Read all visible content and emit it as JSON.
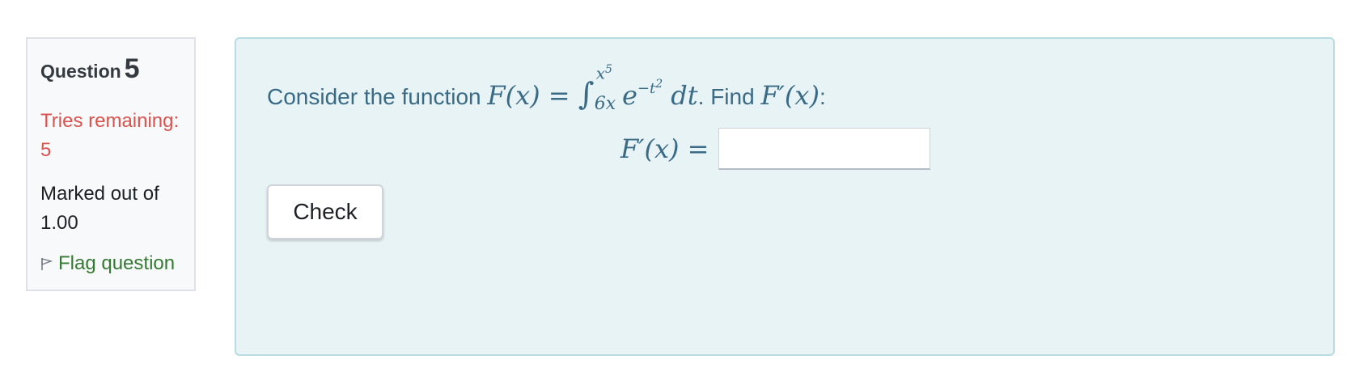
{
  "info": {
    "question_label": "Question",
    "question_number": "5",
    "tries_remaining": "Tries remaining: 5",
    "marked_out_of": "Marked out of 1.00",
    "flag_label": "Flag question"
  },
  "question": {
    "intro_text": "Consider the function",
    "function_lhs": "F(x) =",
    "integral_upper": "x",
    "integral_upper_exp": "5",
    "integral_lower": "6x",
    "integrand_base": "e",
    "integrand_exp": "−t",
    "integrand_exp_sq": "2",
    "differential": "dt",
    "find_text": ". Find",
    "find_target": "F′(x)",
    "find_colon": ":"
  },
  "answer": {
    "lhs": "F′(x) =",
    "value": "",
    "placeholder": ""
  },
  "actions": {
    "check_label": "Check"
  },
  "colors": {
    "tries": "#d9534f",
    "flag": "#357a32",
    "question_text": "#3a6b86",
    "content_bg": "#e7f3f5"
  }
}
